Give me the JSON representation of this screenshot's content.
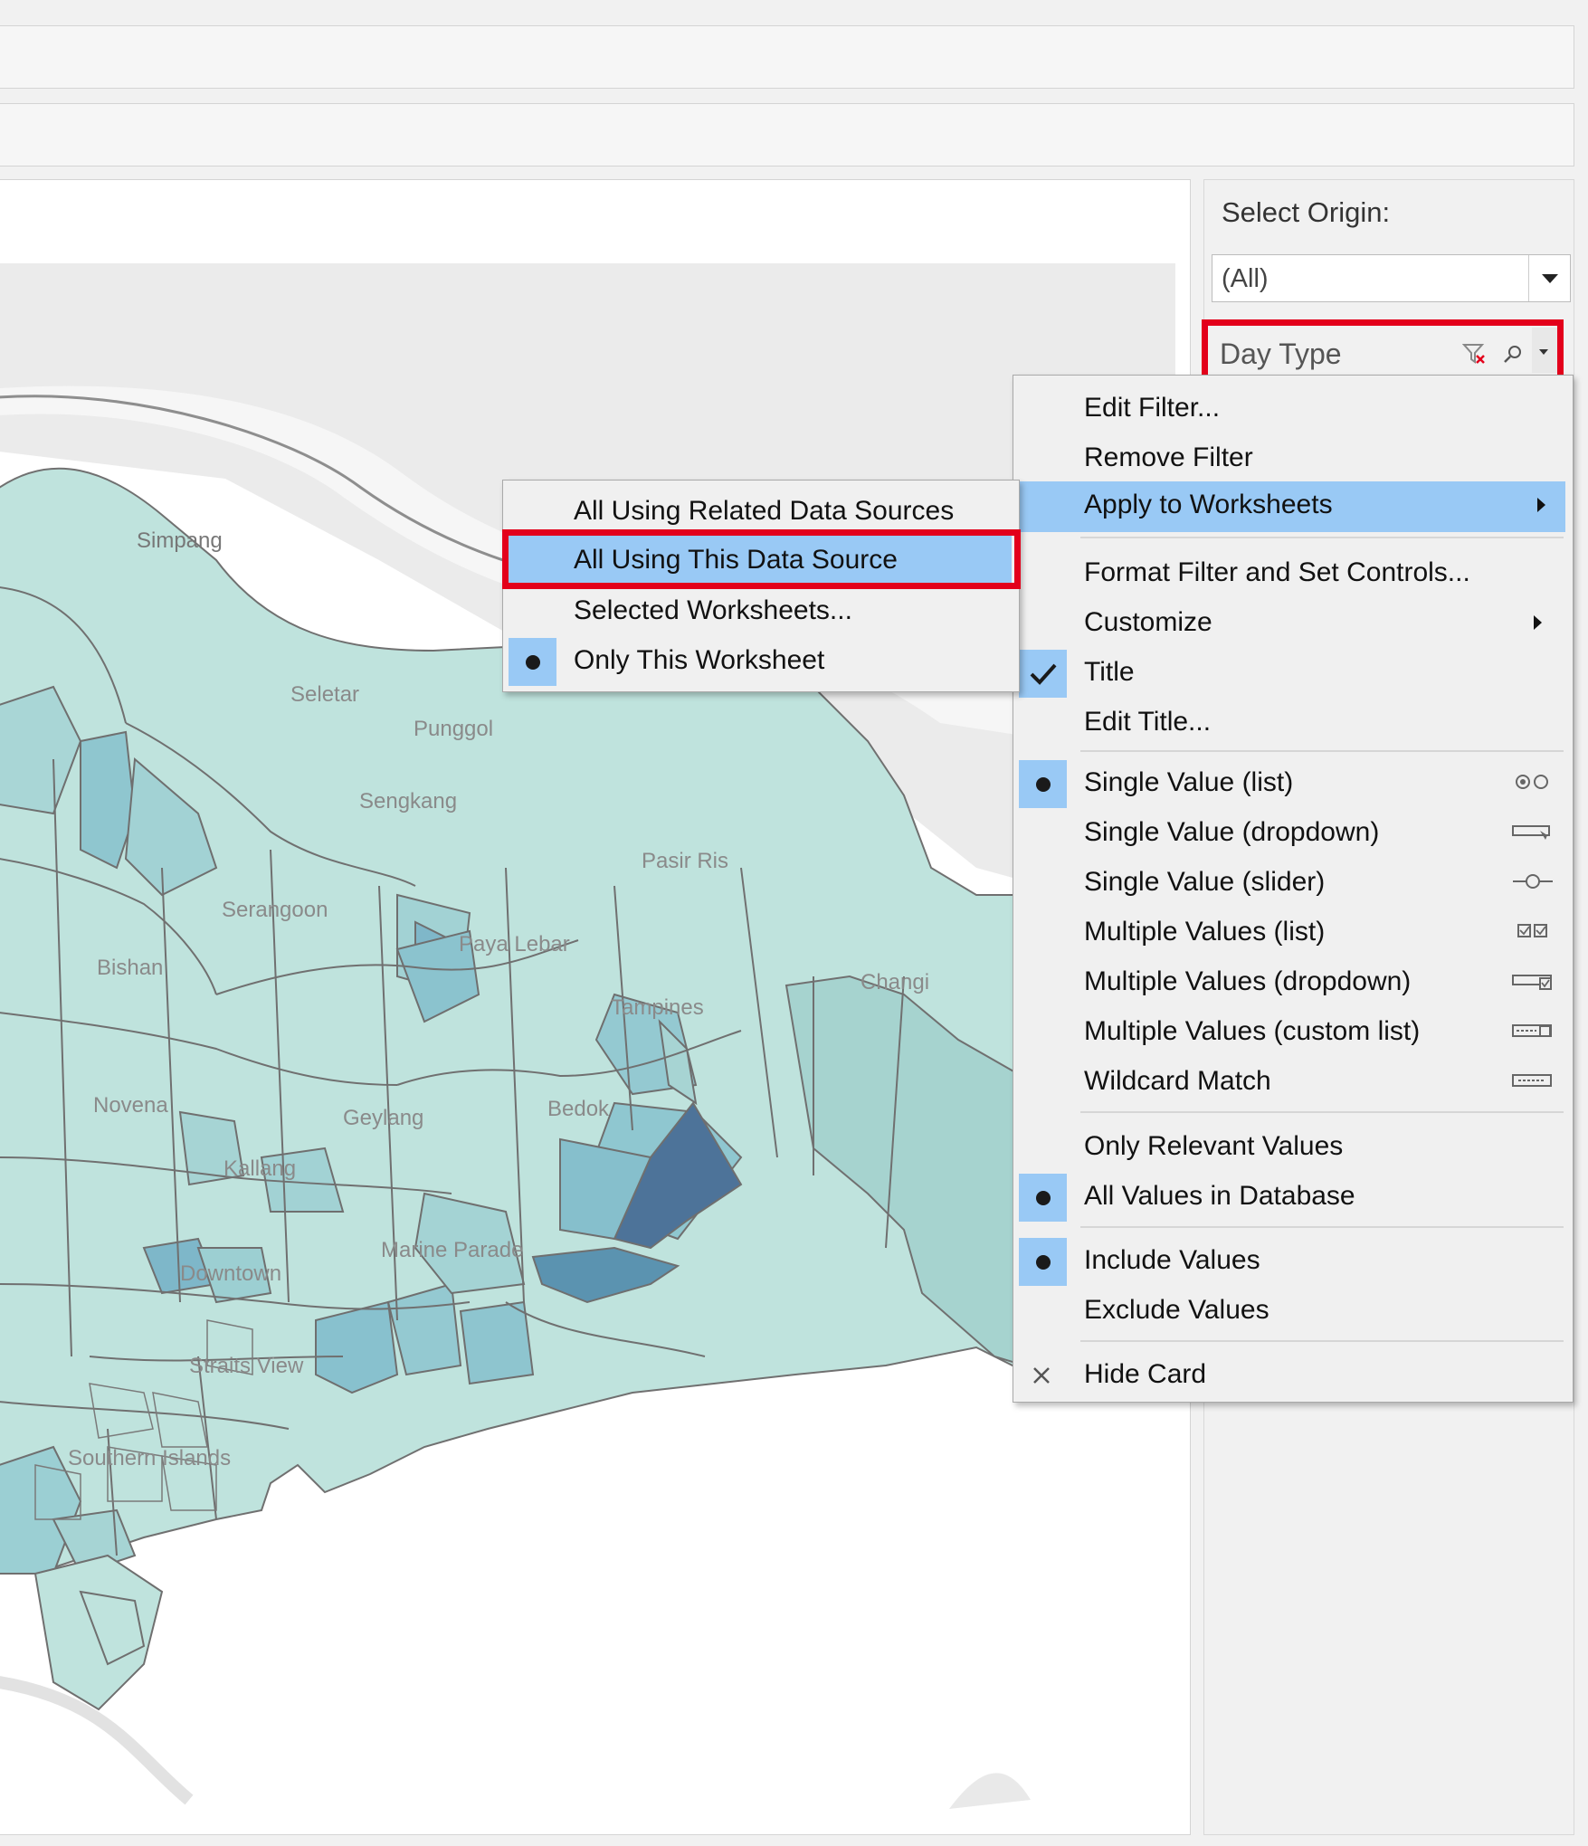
{
  "origin_filter": {
    "label": "Select Origin:",
    "value": "(All)"
  },
  "day_type_card": {
    "title": "Day Type"
  },
  "map_labels": [
    "Simpang",
    "Seletar",
    "Punggol",
    "Sengkang",
    "Pasir Ris",
    "Paya Lebar",
    "Tampines",
    "Changi",
    "Bedok",
    "Serangoon",
    "Bishan",
    "Novena",
    "Kallang",
    "Geylang",
    "Marine Parade",
    "Downtown",
    "Straits View",
    "Southern Islands"
  ],
  "context_menu": {
    "items": [
      "Edit Filter...",
      "Remove Filter",
      "Apply to Worksheets",
      "Format Filter and Set Controls...",
      "Customize",
      "Title",
      "Edit Title...",
      "Single Value (list)",
      "Single Value (dropdown)",
      "Single Value (slider)",
      "Multiple Values (list)",
      "Multiple Values (dropdown)",
      "Multiple Values (custom list)",
      "Wildcard Match",
      "Only Relevant Values",
      "All Values in Database",
      "Include Values",
      "Exclude Values",
      "Hide Card"
    ]
  },
  "submenu": {
    "items": [
      "All Using Related Data Sources",
      "All Using This Data Source",
      "Selected Worksheets...",
      "Only This Worksheet"
    ]
  },
  "colors": {
    "highlight": "#99c9f5",
    "annotation": "#e3001b",
    "map_light": "#bfe3dd",
    "map_dark": "#4f7399"
  }
}
